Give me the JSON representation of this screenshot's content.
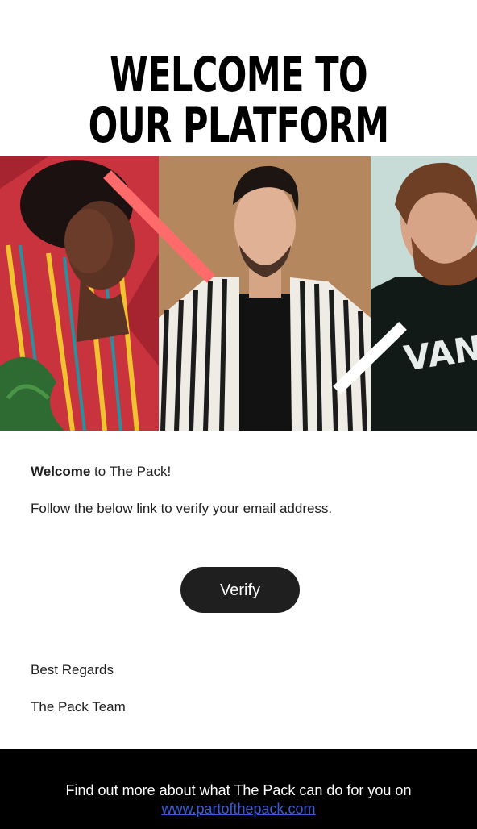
{
  "header": {
    "title_line1": "WELCOME TO",
    "title_line2": "OUR PLATFORM"
  },
  "banner": {
    "photos": [
      "woman-in-colorful-shirt-photo",
      "man-in-striped-shirt-photo",
      "bearded-man-in-black-tee-photo"
    ],
    "shirt_text": "VANS",
    "accent_colors": {
      "coral": "#ff6b6b",
      "white": "#ffffff"
    }
  },
  "body": {
    "greeting_bold": "Welcome",
    "greeting_rest": " to The Pack!",
    "instruction": "Follow the below link to verify your email address.",
    "verify_label": "Verify",
    "regards": "Best Regards",
    "team": "The Pack Team"
  },
  "footer": {
    "text": "Find out more about what The Pack can do for you on",
    "link": "www.partofthepack.com"
  },
  "colors": {
    "button_bg": "#1f1f1f",
    "footer_bg": "#000000",
    "link": "#3d5bd9"
  }
}
